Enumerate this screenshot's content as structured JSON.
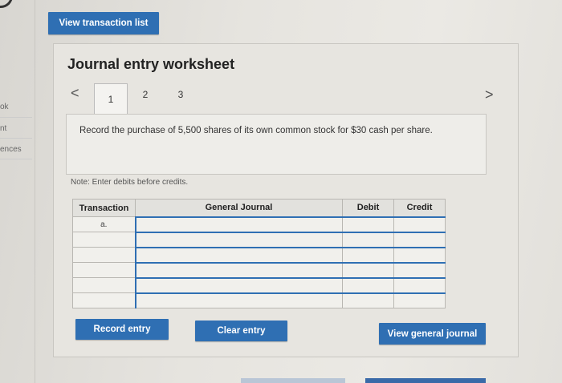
{
  "sidebar": {
    "labels": [
      "ok",
      "nt",
      "ences"
    ]
  },
  "header": {
    "view_transaction_list": "View transaction list"
  },
  "worksheet": {
    "title": "Journal entry worksheet",
    "tabs": [
      "1",
      "2",
      "3"
    ],
    "prev_arrow": "<",
    "next_arrow": ">",
    "instruction": "Record the purchase of 5,500 shares of its own common stock for $30 cash per share.",
    "note": "Note: Enter debits before credits."
  },
  "table": {
    "columns": [
      "Transaction",
      "General Journal",
      "Debit",
      "Credit"
    ],
    "rows": [
      {
        "transaction": "a.",
        "account": "",
        "debit": "",
        "credit": ""
      },
      {
        "transaction": "",
        "account": "",
        "debit": "",
        "credit": ""
      },
      {
        "transaction": "",
        "account": "",
        "debit": "",
        "credit": ""
      },
      {
        "transaction": "",
        "account": "",
        "debit": "",
        "credit": ""
      },
      {
        "transaction": "",
        "account": "",
        "debit": "",
        "credit": ""
      },
      {
        "transaction": "",
        "account": "",
        "debit": "",
        "credit": ""
      }
    ]
  },
  "actions": {
    "record_entry": "Record entry",
    "clear_entry": "Clear entry",
    "view_general_journal": "View general journal"
  },
  "colors": {
    "accent": "#2f6fb3",
    "background": "#e6e4df"
  }
}
